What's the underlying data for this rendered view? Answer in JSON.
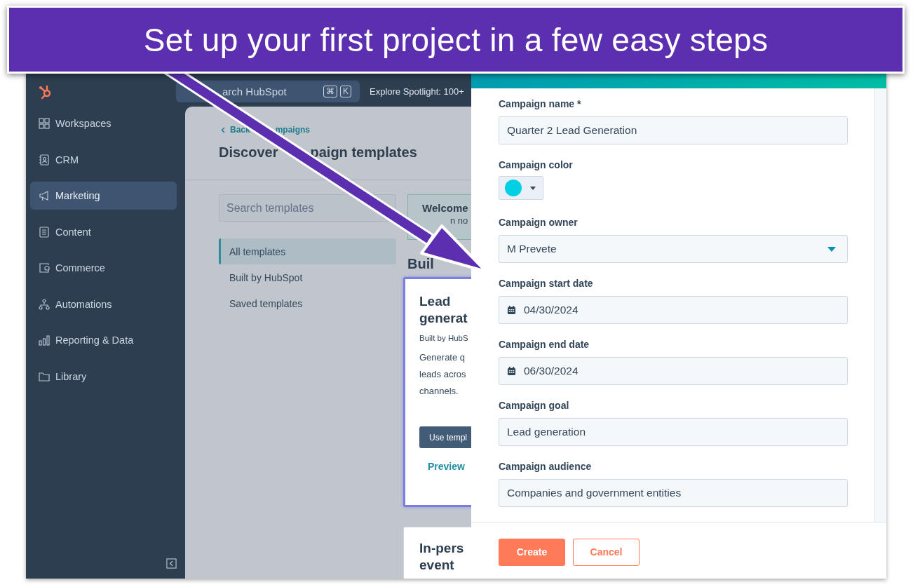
{
  "banner": {
    "text": "Set up your first project in a few easy steps"
  },
  "top_bar": {
    "search_text": "arch HubSpot",
    "shortcut_keys": [
      "⌘",
      "K"
    ],
    "spotlight": "Explore Spotlight: 100+"
  },
  "sidebar": {
    "items": [
      {
        "label": "Workspaces",
        "selected": false
      },
      {
        "label": "CRM",
        "selected": false
      },
      {
        "label": "Marketing",
        "selected": true
      },
      {
        "label": "Content",
        "selected": false
      },
      {
        "label": "Commerce",
        "selected": false
      },
      {
        "label": "Automations",
        "selected": false
      },
      {
        "label": "Reporting & Data",
        "selected": false
      },
      {
        "label": "Library",
        "selected": false
      }
    ]
  },
  "page": {
    "back_link_start": "Back",
    "back_link_end": "mpaigns",
    "title_start": "Discover",
    "title_end": "paign templates"
  },
  "template_search": {
    "placeholder": "Search templates"
  },
  "filters": [
    {
      "label": "All templates",
      "selected": true
    },
    {
      "label": "Built by HubSpot",
      "selected": false
    },
    {
      "label": "Saved templates",
      "selected": false
    }
  ],
  "welcome": {
    "title": "Welcome",
    "text": "n no"
  },
  "section_heading": "Buil",
  "cards": [
    {
      "title": "Lead\ngenerat",
      "source": "Built by HubS",
      "description": "Generate q\nleads acros\nchannels.",
      "button": "Use templ",
      "link": "Preview",
      "selected": true
    },
    {
      "title": "In-pers\nevent",
      "selected": false
    }
  ],
  "form": {
    "fields": [
      {
        "label": "Campaign name *",
        "kind": "text",
        "value": "Quarter 2 Lead Generation"
      },
      {
        "label": "Campaign color",
        "kind": "color",
        "color": "#00d0e4"
      },
      {
        "label": "Campaign owner",
        "kind": "select",
        "value": "M Prevete"
      },
      {
        "label": "Campaign start date",
        "kind": "date",
        "value": "04/30/2024"
      },
      {
        "label": "Campaign end date",
        "kind": "date",
        "value": "06/30/2024"
      },
      {
        "label": "Campaign goal",
        "kind": "text",
        "value": "Lead generation"
      },
      {
        "label": "Campaign audience",
        "kind": "text",
        "value": "Companies and government entities"
      }
    ],
    "buttons": [
      {
        "label": "Create",
        "kind": "primary"
      },
      {
        "label": "Cancel",
        "kind": "secondary"
      }
    ]
  }
}
